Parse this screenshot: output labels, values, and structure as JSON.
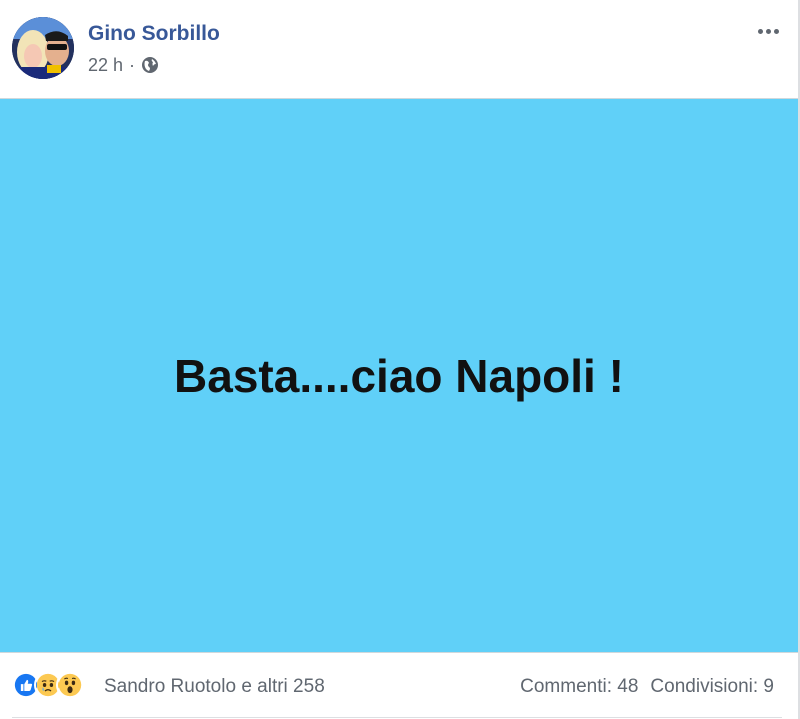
{
  "post": {
    "author": "Gino Sorbillo",
    "time": "22 h",
    "dot": "·",
    "privacy_icon": "globe-icon",
    "more_icon": "more-options-icon",
    "text": "Basta....ciao Napoli !",
    "background_color": "#60d0f8"
  },
  "footer": {
    "reaction_icons": [
      "like-icon",
      "sad-icon",
      "wow-icon"
    ],
    "reactors": "Sandro Ruotolo e altri 258",
    "comments": "Commenti: 48",
    "shares": "Condivisioni: 9"
  },
  "colors": {
    "author_link": "#385898",
    "meta_text": "#606770",
    "like_blue": "#1877f2"
  }
}
